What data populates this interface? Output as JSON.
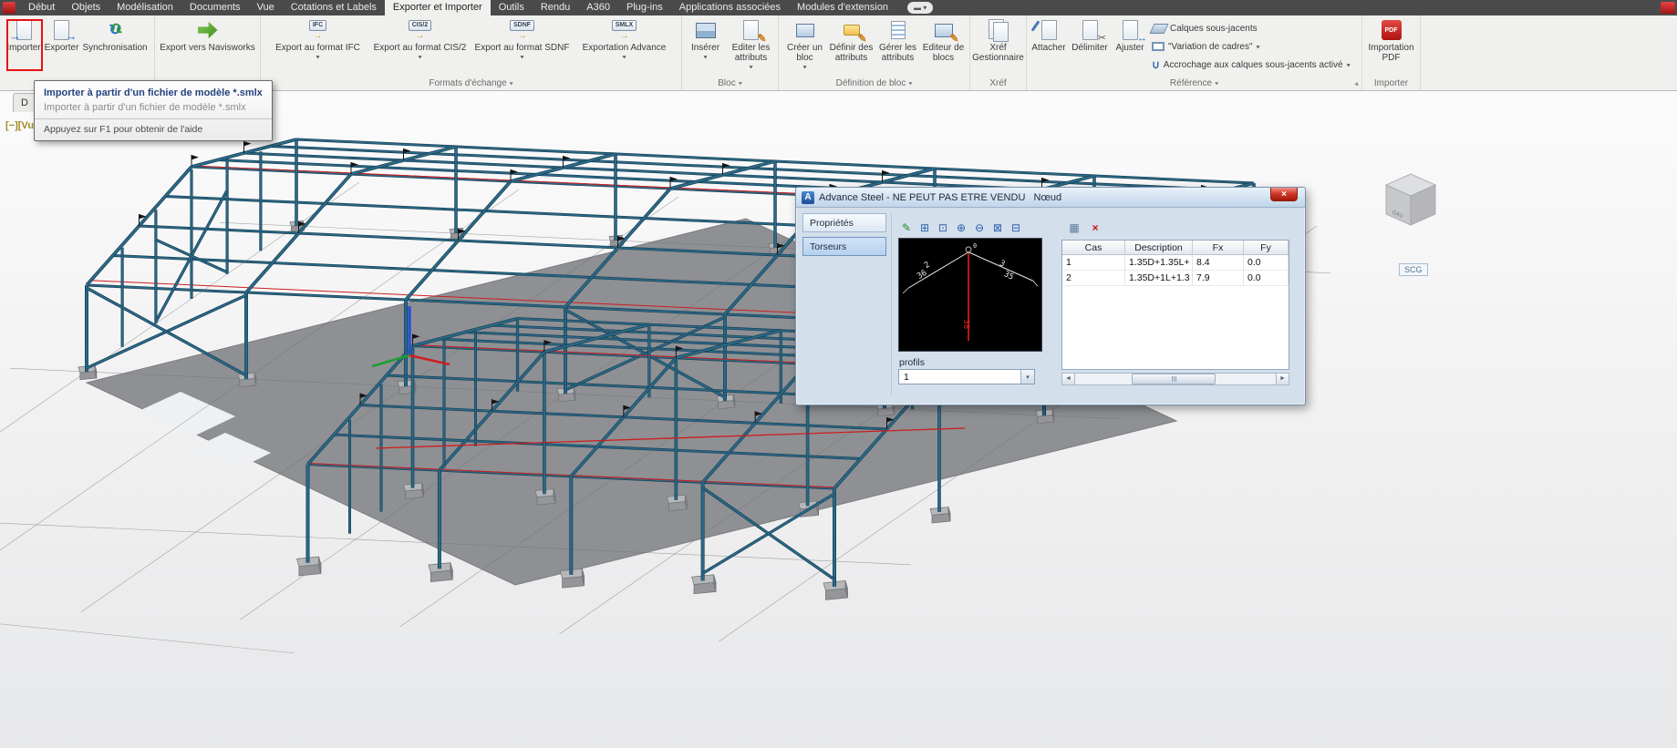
{
  "menubar": {
    "tabs": [
      "Début",
      "Objets",
      "Modélisation",
      "Documents",
      "Vue",
      "Cotations et Labels",
      "Exporter et Importer",
      "Outils",
      "Rendu",
      "A360",
      "Plug-ins",
      "Applications associées",
      "Modules d'extension"
    ],
    "active_tab": "Exporter et Importer"
  },
  "ribbon": {
    "buttons": {
      "importer": "Importer",
      "exporter": "Exporter",
      "synchronisation": "Synchronisation",
      "navisworks": "Export vers Navisworks",
      "ifc": "Export au format IFC",
      "cis2": "Export au format CIS/2",
      "sdnf": "Export au format SDNF",
      "advance": "Exportation Advance",
      "inserer": "Insérer",
      "editer_attributs": "Editer les attributs",
      "creer_bloc": "Créer un bloc",
      "definir_attributs": "Définir des attributs",
      "gerer_attributs": "Gérer les attributs",
      "editeur_blocs": "Editeur de blocs",
      "xref_gestionnaire": "Xréf Gestionnaire",
      "attacher": "Attacher",
      "delimiter": "Délimiter",
      "ajuster": "Ajuster",
      "calques_sous_jacents": "Calques sous-jacents",
      "variation_cadres": "\"Variation de cadres\"",
      "accrochage": "Accrochage aux calques sous-jacents activé",
      "importation_pdf": "Importation PDF"
    },
    "badges": {
      "ifc": "IFC",
      "cis2": "CIS/2",
      "sdnf": "SDNF",
      "advance": "SMLX",
      "pdf": "PDF"
    },
    "group_labels": {
      "formats": "Formats d'échange",
      "bloc": "Bloc",
      "definition_bloc": "Définition de bloc",
      "xref": "Xréf",
      "reference": "Référence",
      "importer": "Importer"
    }
  },
  "icons": {
    "dropdown": "▾",
    "close": "×",
    "scroll_left": "◄",
    "scroll_right": "►",
    "edit": "✎",
    "zoom_window": "⊞",
    "zoom_dynamic": "⊡",
    "zoom_in": "⊕",
    "zoom_out": "⊖",
    "zoom_extents": "⊠",
    "zoom_previous": "⊟",
    "grid": "▦",
    "delete": "×"
  },
  "tooltip": {
    "title": "Importer à partir d'un fichier de modèle *.smlx",
    "description": "Importer à partir d'un fichier de modèle *.smlx",
    "help": "Appuyez sur F1 pour obtenir de l'aide"
  },
  "viewport": {
    "doc_tab": "D",
    "view_controls": "[−][Vu",
    "viewcube_label": "GAU",
    "ucs_button": "SCG"
  },
  "dialog": {
    "title": "Advance Steel - NE PEUT PAS ETRE VENDU   Nœud",
    "nav": {
      "proprietes": "Propriétés",
      "torseurs": "Torseurs"
    },
    "profils_label": "profils",
    "profils_value": "1",
    "diagram": {
      "left_top": "2",
      "left_bottom": "36",
      "right_top": "3",
      "right_bottom": "35",
      "top": "0",
      "red_value": "38"
    },
    "table": {
      "headers": [
        "Cas",
        "Description",
        "Fx",
        "Fy"
      ],
      "rows": [
        [
          "1",
          "1.35D+1.35L+",
          "8.4",
          "0.0"
        ],
        [
          "2",
          "1.35D+1L+1.3",
          "7.9",
          "0.0"
        ]
      ]
    }
  }
}
